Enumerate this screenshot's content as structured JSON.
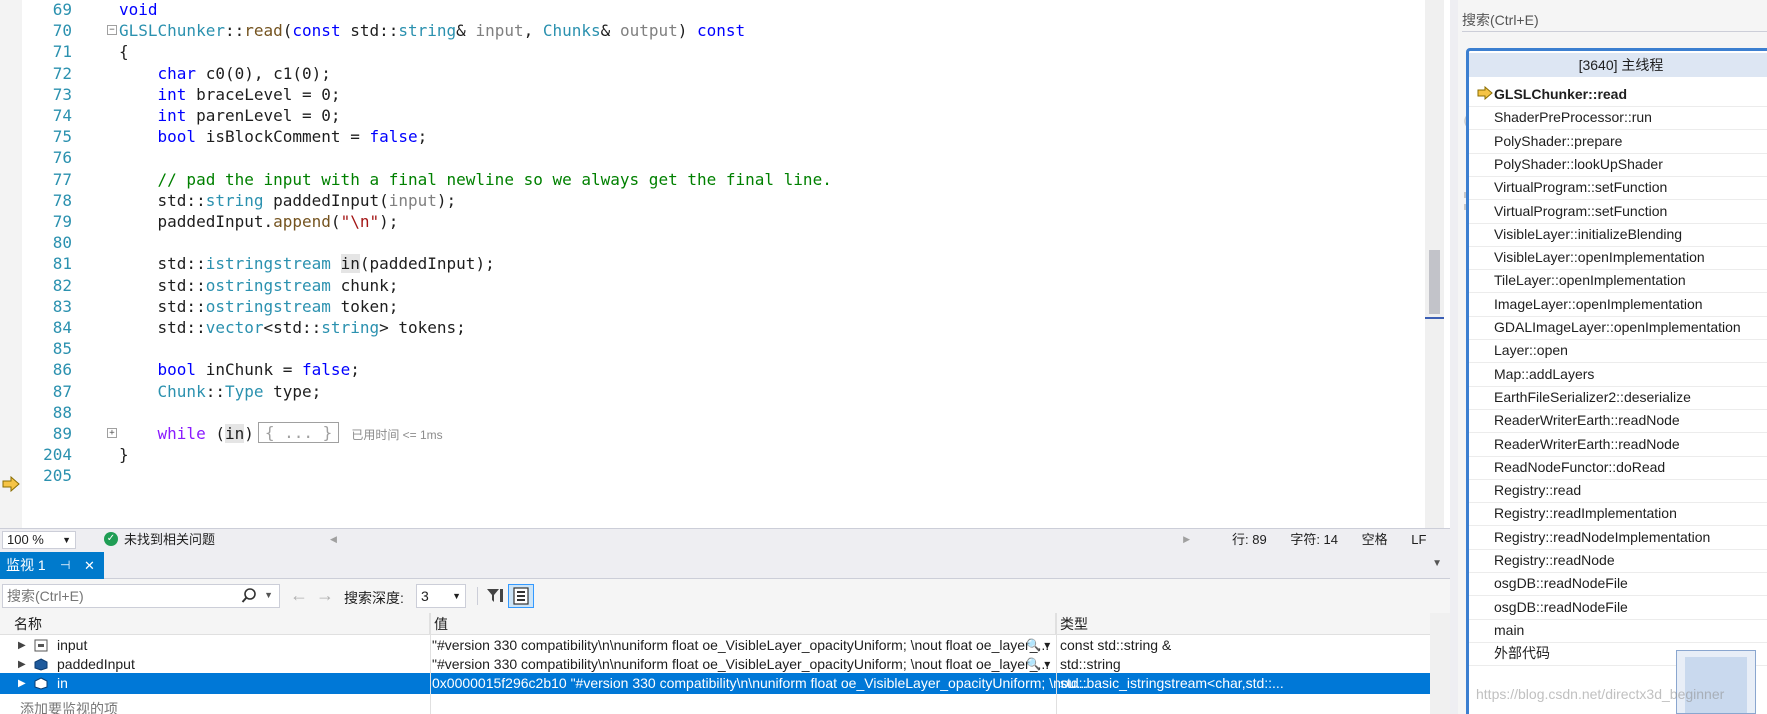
{
  "editor": {
    "lines": [
      {
        "num": "69",
        "segs": [
          {
            "c": "k",
            "t": "void"
          }
        ]
      },
      {
        "num": "70",
        "fold": "minus",
        "segs": [
          {
            "c": "t",
            "t": "GLSLChunker"
          },
          {
            "c": "",
            "t": "::"
          },
          {
            "c": "fn",
            "t": "read"
          },
          {
            "c": "",
            "t": "("
          },
          {
            "c": "k",
            "t": "const"
          },
          {
            "c": "",
            "t": " std::"
          },
          {
            "c": "t",
            "t": "string"
          },
          {
            "c": "",
            "t": "& "
          },
          {
            "c": "pm",
            "t": "input"
          },
          {
            "c": "",
            "t": ", "
          },
          {
            "c": "t",
            "t": "Chunks"
          },
          {
            "c": "",
            "t": "& "
          },
          {
            "c": "pm",
            "t": "output"
          },
          {
            "c": "",
            "t": ") "
          },
          {
            "c": "k",
            "t": "const"
          }
        ]
      },
      {
        "num": "71",
        "segs": [
          {
            "c": "",
            "t": "{"
          }
        ]
      },
      {
        "num": "72",
        "segs": [
          {
            "c": "",
            "t": "    "
          },
          {
            "c": "k",
            "t": "char"
          },
          {
            "c": "",
            "t": " c0(0), c1(0);"
          }
        ]
      },
      {
        "num": "73",
        "segs": [
          {
            "c": "",
            "t": "    "
          },
          {
            "c": "k",
            "t": "int"
          },
          {
            "c": "",
            "t": " braceLevel = 0;"
          }
        ]
      },
      {
        "num": "74",
        "segs": [
          {
            "c": "",
            "t": "    "
          },
          {
            "c": "k",
            "t": "int"
          },
          {
            "c": "",
            "t": " parenLevel = 0;"
          }
        ]
      },
      {
        "num": "75",
        "segs": [
          {
            "c": "",
            "t": "    "
          },
          {
            "c": "k",
            "t": "bool"
          },
          {
            "c": "",
            "t": " isBlockComment = "
          },
          {
            "c": "k",
            "t": "false"
          },
          {
            "c": "",
            "t": ";"
          }
        ]
      },
      {
        "num": "76",
        "segs": []
      },
      {
        "num": "77",
        "segs": [
          {
            "c": "",
            "t": "    "
          },
          {
            "c": "cm",
            "t": "// pad the input with a final newline so we always get the final line."
          }
        ]
      },
      {
        "num": "78",
        "segs": [
          {
            "c": "",
            "t": "    std::"
          },
          {
            "c": "t",
            "t": "string"
          },
          {
            "c": "",
            "t": " paddedInput("
          },
          {
            "c": "pm",
            "t": "input"
          },
          {
            "c": "",
            "t": ");"
          }
        ]
      },
      {
        "num": "79",
        "segs": [
          {
            "c": "",
            "t": "    paddedInput."
          },
          {
            "c": "fn",
            "t": "append"
          },
          {
            "c": "",
            "t": "("
          },
          {
            "c": "s",
            "t": "\"\\n\""
          },
          {
            "c": "",
            "t": ");"
          }
        ]
      },
      {
        "num": "80",
        "segs": []
      },
      {
        "num": "81",
        "segs": [
          {
            "c": "",
            "t": "    std::"
          },
          {
            "c": "t",
            "t": "istringstream"
          },
          {
            "c": "",
            "t": " "
          },
          {
            "c": "hl",
            "t": "in"
          },
          {
            "c": "",
            "t": "(paddedInput);"
          }
        ]
      },
      {
        "num": "82",
        "segs": [
          {
            "c": "",
            "t": "    std::"
          },
          {
            "c": "t",
            "t": "ostringstream"
          },
          {
            "c": "",
            "t": " chunk;"
          }
        ]
      },
      {
        "num": "83",
        "segs": [
          {
            "c": "",
            "t": "    std::"
          },
          {
            "c": "t",
            "t": "ostringstream"
          },
          {
            "c": "",
            "t": " token;"
          }
        ]
      },
      {
        "num": "84",
        "segs": [
          {
            "c": "",
            "t": "    std::"
          },
          {
            "c": "t",
            "t": "vector"
          },
          {
            "c": "",
            "t": "<std::"
          },
          {
            "c": "t",
            "t": "string"
          },
          {
            "c": "",
            "t": "> tokens;"
          }
        ]
      },
      {
        "num": "85",
        "segs": []
      },
      {
        "num": "86",
        "segs": [
          {
            "c": "",
            "t": "    "
          },
          {
            "c": "k",
            "t": "bool"
          },
          {
            "c": "",
            "t": " inChunk = "
          },
          {
            "c": "k",
            "t": "false"
          },
          {
            "c": "",
            "t": ";"
          }
        ]
      },
      {
        "num": "87",
        "segs": [
          {
            "c": "",
            "t": "    "
          },
          {
            "c": "t",
            "t": "Chunk"
          },
          {
            "c": "",
            "t": "::"
          },
          {
            "c": "t",
            "t": "Type"
          },
          {
            "c": "",
            "t": " type;"
          }
        ]
      },
      {
        "num": "88",
        "segs": []
      },
      {
        "num": "89",
        "fold": "plus",
        "segs": [
          {
            "c": "",
            "t": "    "
          },
          {
            "c": "p",
            "t": "while"
          },
          {
            "c": "",
            "t": " ("
          },
          {
            "c": "hl",
            "t": "in"
          },
          {
            "c": "",
            "t": ")"
          }
        ],
        "collapsed": "{ ... }",
        "elapsed": "已用时间 <= 1ms"
      },
      {
        "num": "204",
        "segs": [
          {
            "c": "",
            "t": "}"
          }
        ]
      },
      {
        "num": "205",
        "segs": []
      }
    ]
  },
  "status": {
    "zoom": "100 %",
    "issues": "未找到相关问题",
    "line": "行: 89",
    "char": "字符: 14",
    "ws": "空格",
    "eol": "LF"
  },
  "watch": {
    "title": "监视 1",
    "search_placeholder": "搜索(Ctrl+E)",
    "depth_label": "搜索深度:",
    "depth_value": "3",
    "col_name": "名称",
    "col_value": "值",
    "col_type": "类型",
    "rows": [
      {
        "name": "input",
        "value": "\"#version 330 compatibility\\n\\nuniform float oe_VisibleLayer_opacityUniform; \\nout float oe_layer_...",
        "type": "const std::string &",
        "selected": false
      },
      {
        "name": "paddedInput",
        "value": "\"#version 330 compatibility\\n\\nuniform float oe_VisibleLayer_opacityUniform; \\nout float oe_layer_...",
        "type": "std::string",
        "selected": false
      },
      {
        "name": "in",
        "value": "0x0000015f296c2b10 \"#version 330 compatibility\\n\\nuniform float oe_VisibleLayer_opacityUniform; \\nou...",
        "type": "std::basic_istringstream<char,std::...",
        "selected": true
      }
    ],
    "add_item": "添加要监视的项"
  },
  "callstack": {
    "search_placeholder": "搜索(Ctrl+E)",
    "thread": "[3640] 主线程",
    "frames": [
      "GLSLChunker::read",
      "ShaderPreProcessor::run",
      "PolyShader::prepare",
      "PolyShader::lookUpShader",
      "VirtualProgram::setFunction",
      "VirtualProgram::setFunction",
      "VisibleLayer::initializeBlending",
      "VisibleLayer::openImplementation",
      "TileLayer::openImplementation",
      "ImageLayer::openImplementation",
      "GDALImageLayer::openImplementation",
      "Layer::open",
      "Map::addLayers",
      "EarthFileSerializer2::deserialize",
      "ReaderWriterEarth::readNode",
      "ReaderWriterEarth::readNode",
      "ReadNodeFunctor::doRead",
      "Registry::read",
      "Registry::readImplementation",
      "Registry::readNodeImplementation",
      "Registry::readNode",
      "osgDB::readNodeFile",
      "osgDB::readNodeFile",
      "main",
      "外部代码"
    ]
  },
  "watermark": "https://blog.csdn.net/directx3d_beginner",
  "colors": {
    "accent": "#007acc",
    "selection": "#0078d7",
    "keyword": "#0000ff",
    "type": "#2b91af",
    "comment": "#008000",
    "string": "#a31515"
  }
}
